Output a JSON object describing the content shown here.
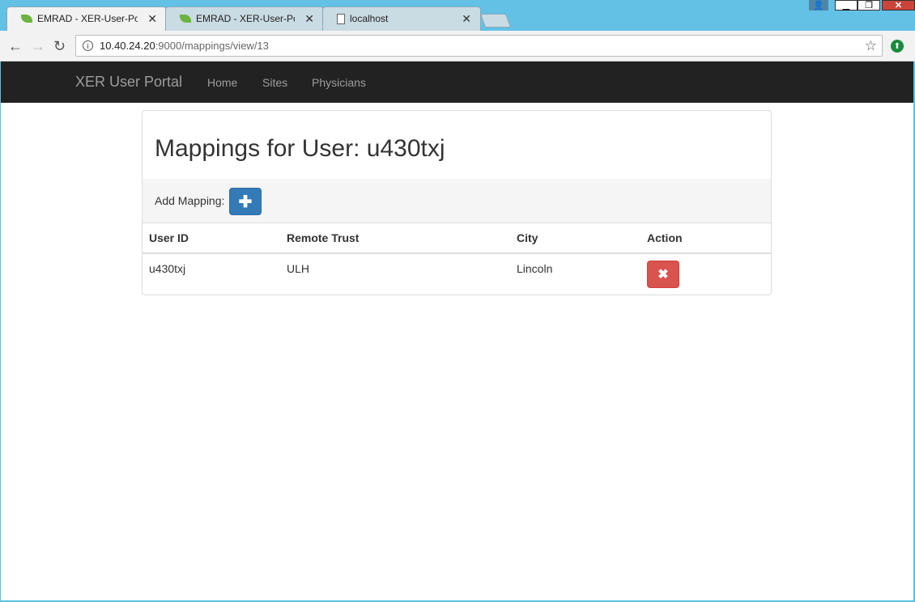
{
  "browser": {
    "tabs": [
      {
        "title": "EMRAD - XER-User-Porta",
        "icon": "spring-leaf-icon",
        "active": true
      },
      {
        "title": "EMRAD - XER-User-Porta",
        "icon": "spring-leaf-icon",
        "active": false
      },
      {
        "title": "localhost",
        "icon": "document-icon",
        "active": false
      }
    ],
    "url_host": "10.40.24.20",
    "url_path": ":9000/mappings/view/13"
  },
  "navbar": {
    "brand": "XER User Portal",
    "links": [
      "Home",
      "Sites",
      "Physicians"
    ]
  },
  "main": {
    "title": "Mappings for User: u430txj",
    "add_label": "Add Mapping:",
    "table": {
      "headers": [
        "User ID",
        "Remote Trust",
        "City",
        "Action"
      ],
      "rows": [
        {
          "user_id": "u430txj",
          "remote_trust": "ULH",
          "city": "Lincoln"
        }
      ]
    }
  },
  "colors": {
    "primary": "#337ab7",
    "danger": "#d9534f",
    "navbar": "#222222"
  }
}
